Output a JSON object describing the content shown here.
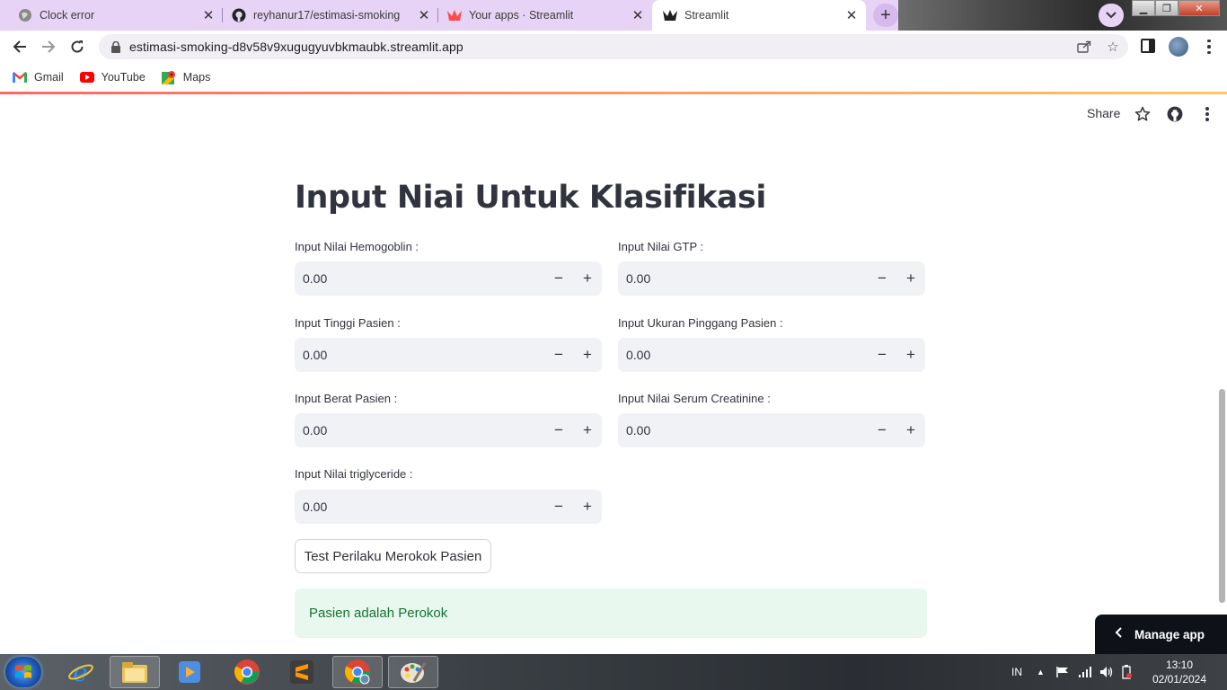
{
  "browser": {
    "tabs": [
      {
        "title": "Clock error",
        "icon": "globe-icon"
      },
      {
        "title": "reyhanur17/estimasi-smoking",
        "icon": "github-icon"
      },
      {
        "title": "Your apps · Streamlit",
        "icon": "streamlit-icon"
      },
      {
        "title": "Streamlit",
        "icon": "streamlit-icon",
        "active": true
      }
    ],
    "url": "estimasi-smoking-d8v58v9xugugyuvbkmaubk.streamlit.app",
    "bookmarks": [
      {
        "label": "Gmail",
        "icon": "gmail-icon"
      },
      {
        "label": "YouTube",
        "icon": "youtube-icon"
      },
      {
        "label": "Maps",
        "icon": "maps-icon"
      }
    ]
  },
  "app_header": {
    "share_label": "Share"
  },
  "main": {
    "title": "Input Niai Untuk Klasifikasi",
    "fields": [
      {
        "label": "Input Nilai Hemogoblin :",
        "value": "0.00"
      },
      {
        "label": "Input Nilai GTP :",
        "value": "0.00"
      },
      {
        "label": "Input Tinggi Pasien :",
        "value": "0.00"
      },
      {
        "label": "Input Ukuran Pinggang Pasien :",
        "value": "0.00"
      },
      {
        "label": "Input Berat Pasien :",
        "value": "0.00"
      },
      {
        "label": "Input Nilai Serum Creatinine :",
        "value": "0.00"
      },
      {
        "label": "Input Nilai triglyceride :",
        "value": "0.00"
      }
    ],
    "stepper_minus": "−",
    "stepper_plus": "+",
    "submit_label": "Test Perilaku Merokok Pasien",
    "result_text": "Pasien adalah Perokok"
  },
  "manage_app": {
    "label": "Manage app"
  },
  "taskbar": {
    "language": "IN",
    "time": "13:10",
    "date": "02/01/2024"
  },
  "colors": {
    "tab_strip": "#e6d3f5",
    "input_bg": "#f0f2f6",
    "success_bg": "#e8f8ee",
    "success_text": "#177233",
    "text": "#31333f"
  }
}
